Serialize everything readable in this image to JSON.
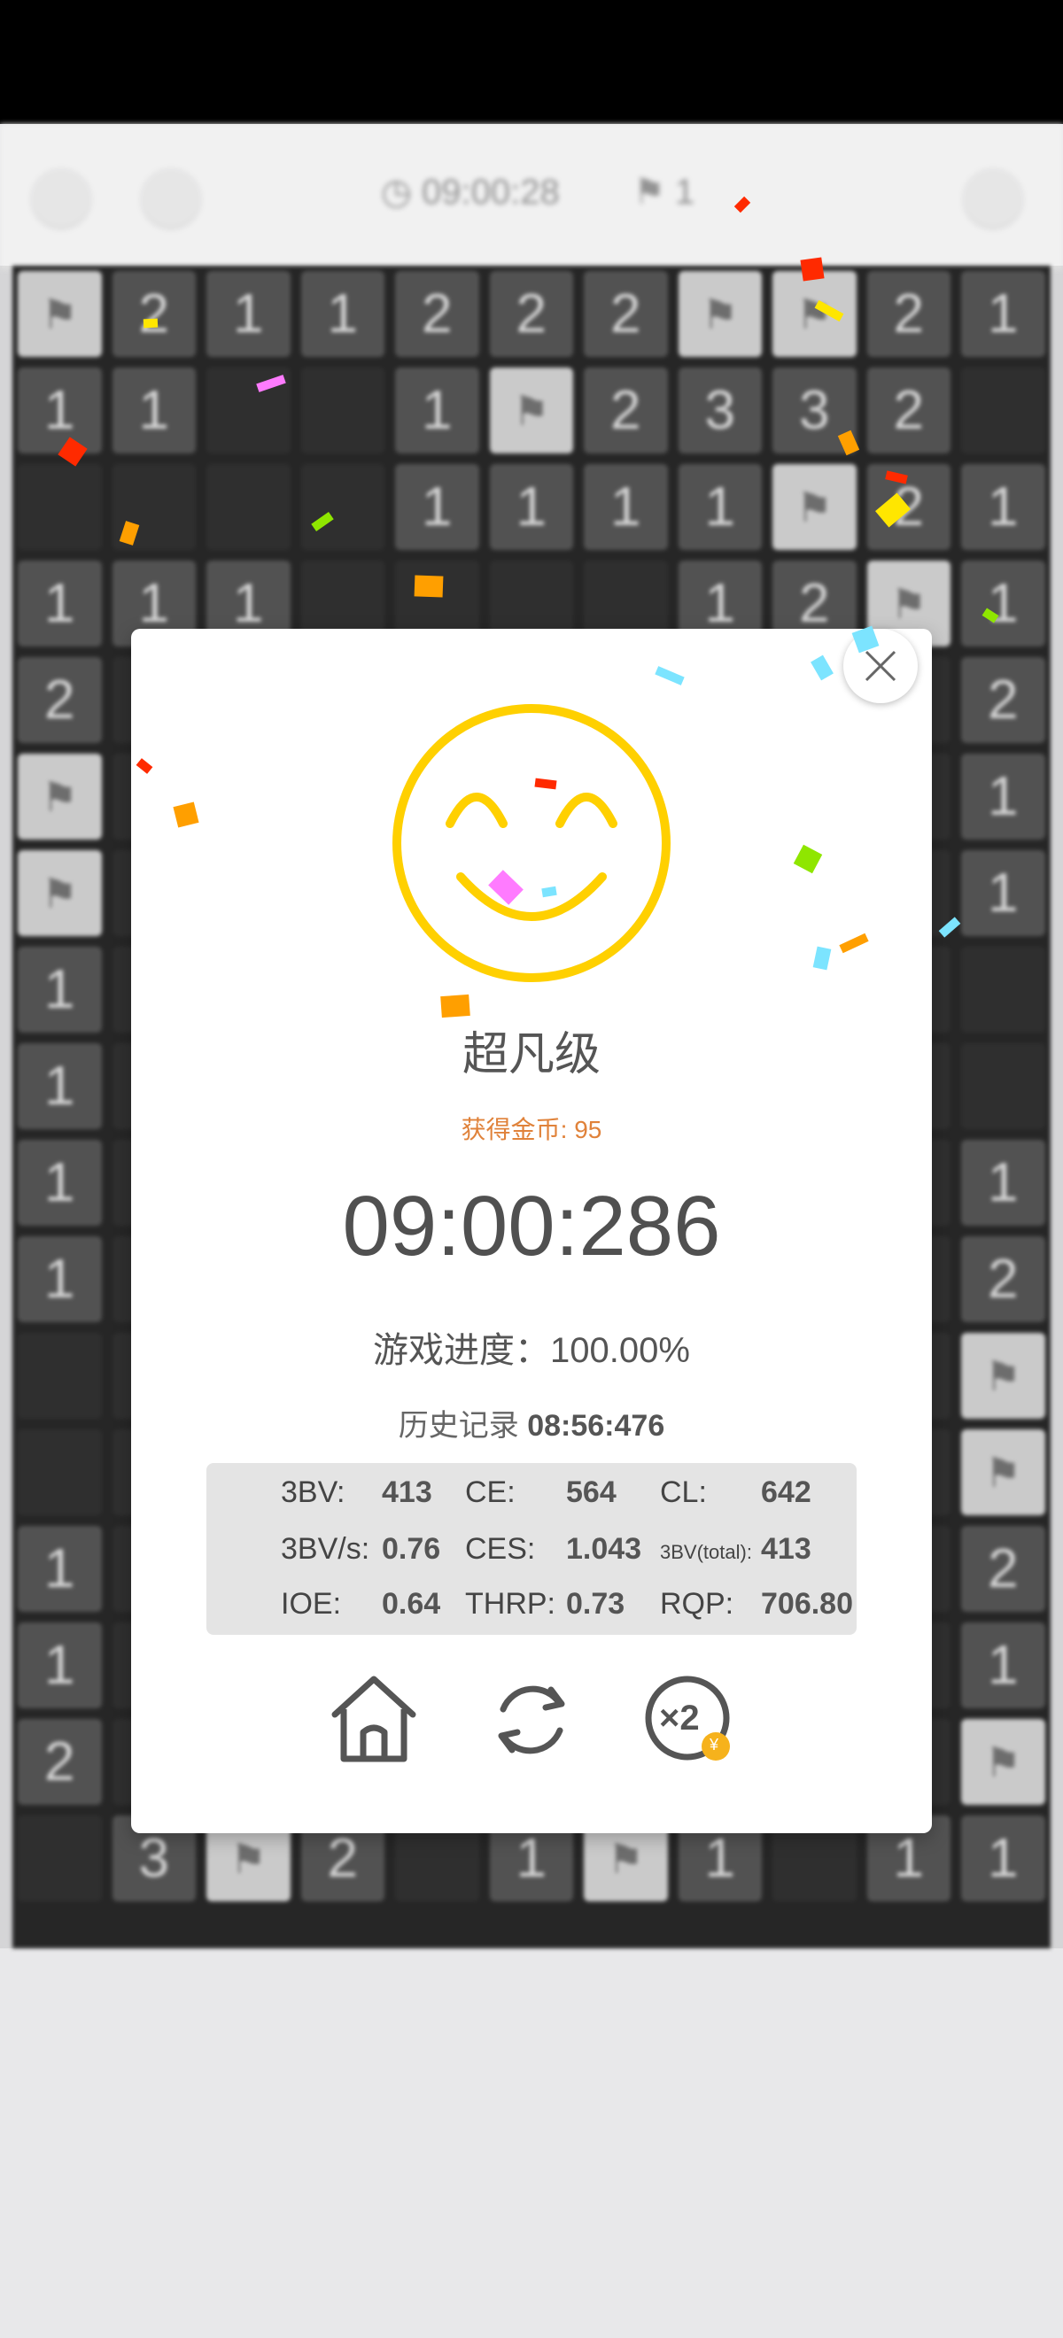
{
  "topbar": {
    "timer": "09:00:28",
    "flags": "1"
  },
  "board": {
    "rows": [
      [
        "F",
        "2",
        "1",
        "1",
        "2",
        "2",
        "2",
        "F",
        "F",
        "2",
        "1"
      ],
      [
        "1",
        "1",
        "",
        "",
        "1",
        "F",
        "2",
        "3",
        "3",
        "2",
        ""
      ],
      [
        "",
        "",
        "",
        "",
        "1",
        "1",
        "1",
        "1",
        "F",
        "2",
        "1"
      ],
      [
        "1",
        "1",
        "1",
        "",
        "",
        "",
        "",
        "1",
        "2",
        "F",
        "1"
      ],
      [
        "2",
        "",
        "",
        "",
        "",
        "",
        "",
        "",
        "",
        "",
        "2"
      ],
      [
        "F",
        "",
        "",
        "",
        "",
        "",
        "",
        "",
        "",
        "",
        "1"
      ],
      [
        "F",
        "",
        "",
        "",
        "",
        "",
        "",
        "",
        "",
        "",
        "1"
      ],
      [
        "1",
        "",
        "",
        "",
        "",
        "",
        "",
        "",
        "",
        "",
        ""
      ],
      [
        "1",
        "",
        "",
        "",
        "",
        "",
        "",
        "",
        "",
        "",
        ""
      ],
      [
        "1",
        "",
        "",
        "",
        "",
        "",
        "",
        "",
        "",
        "",
        "1"
      ],
      [
        "1",
        "",
        "",
        "",
        "",
        "",
        "",
        "",
        "",
        "",
        "2"
      ],
      [
        "",
        "",
        "",
        "",
        "",
        "",
        "",
        "",
        "",
        "",
        "F"
      ],
      [
        "",
        "",
        "",
        "",
        "",
        "",
        "",
        "",
        "",
        "",
        "F"
      ],
      [
        "1",
        "",
        "",
        "",
        "",
        "",
        "",
        "",
        "",
        "",
        "2"
      ],
      [
        "1",
        "",
        "",
        "",
        "",
        "",
        "",
        "",
        "",
        "",
        "1"
      ],
      [
        "2",
        "",
        "",
        "",
        "",
        "",
        "",
        "",
        "",
        "",
        "F"
      ],
      [
        "",
        "3",
        "F",
        "2",
        "",
        "1",
        "F",
        "1",
        "",
        "1",
        "1"
      ]
    ]
  },
  "dialog": {
    "rank": "超凡级",
    "coins": "获得金币: 95",
    "time": "09:00:286",
    "progress": "游戏进度：100.00%",
    "history_label": "历史记录",
    "history_value": "08:56:476",
    "stats": {
      "bv_label": "3BV:",
      "bv": "413",
      "ce_label": "CE:",
      "ce": "564",
      "cl_label": "CL:",
      "cl": "642",
      "bvs_label": "3BV/s:",
      "bvs": "0.76",
      "ces_label": "CES:",
      "ces": "1.043",
      "bvtotal_label": "3BV(total):",
      "bvtotal": "413",
      "ioe_label": "IOE:",
      "ioe": "0.64",
      "thrp_label": "THRP:",
      "thrp": "0.73",
      "rqp_label": "RQP:",
      "rqp": "706.80"
    },
    "coin_badge": "¥",
    "double_label": "×2"
  },
  "colors": {
    "face": "#ffd000",
    "coins_text": "#e0823a",
    "confetti": [
      "#ff2a00",
      "#ffe600",
      "#ff9f00",
      "#ff7bff",
      "#7ce4ff",
      "#8fe600"
    ]
  },
  "icons": [
    "board-icon",
    "refresh-icon",
    "clock-icon",
    "flag-icon",
    "share-icon",
    "close-icon",
    "home-icon",
    "restart-icon",
    "double-coins-icon",
    "smiley-face-icon"
  ]
}
